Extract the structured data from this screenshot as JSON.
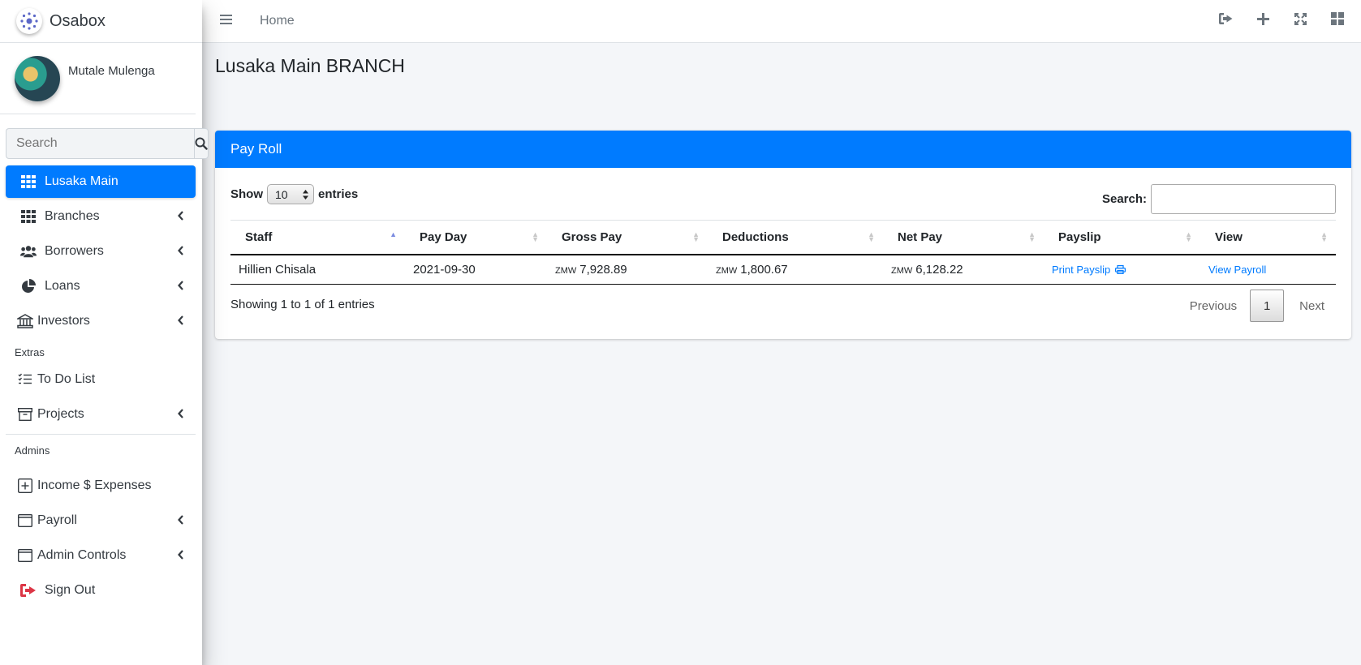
{
  "brand": {
    "name": "Osabox"
  },
  "user": {
    "name": "Mutale Mulenga"
  },
  "sidebar": {
    "search_placeholder": "Search",
    "items": [
      {
        "label": "Lusaka Main",
        "icon": "grid-icon",
        "active": true
      },
      {
        "label": "Branches",
        "icon": "grid-icon"
      },
      {
        "label": "Borrowers",
        "icon": "users-icon"
      },
      {
        "label": "Loans",
        "icon": "pie-chart-icon"
      },
      {
        "label": "Investors",
        "icon": "bank-icon"
      }
    ],
    "extras_header": "Extras",
    "extras": [
      {
        "label": "To Do List",
        "icon": "list-icon"
      },
      {
        "label": "Projects",
        "icon": "archive-icon"
      }
    ],
    "admins_header": "Admins",
    "admins": [
      {
        "label": "Income $ Expenses",
        "icon": "plus-square-icon"
      },
      {
        "label": "Payroll",
        "icon": "window-icon"
      },
      {
        "label": "Admin Controls",
        "icon": "window-icon"
      },
      {
        "label": "Sign Out",
        "icon": "sign-out-icon"
      }
    ]
  },
  "topbar": {
    "home_label": "Home",
    "icons": [
      "sign-out-icon",
      "plus-icon",
      "expand-icon",
      "apps-grid-icon"
    ]
  },
  "page": {
    "title": "Lusaka Main BRANCH"
  },
  "card": {
    "title": "Pay Roll",
    "show_label": "Show",
    "entries_value": "10",
    "entries_label": "entries",
    "search_label": "Search:",
    "columns": [
      "Staff",
      "Pay Day",
      "Gross Pay",
      "Deductions",
      "Net Pay",
      "Payslip",
      "View"
    ],
    "rows": [
      {
        "staff": "Hillien Chisala",
        "pay_day": "2021-09-30",
        "currency": "ZMW",
        "gross_pay": "7,928.89",
        "deductions": "1,800.67",
        "net_pay": "6,128.22",
        "payslip_link": "Print Payslip",
        "view_link": "View Payroll"
      }
    ],
    "info": "Showing 1 to 1 of 1 entries",
    "pager": {
      "previous": "Previous",
      "current": "1",
      "next": "Next"
    }
  },
  "colors": {
    "primary": "#007bff",
    "signout": "#dc3545"
  }
}
